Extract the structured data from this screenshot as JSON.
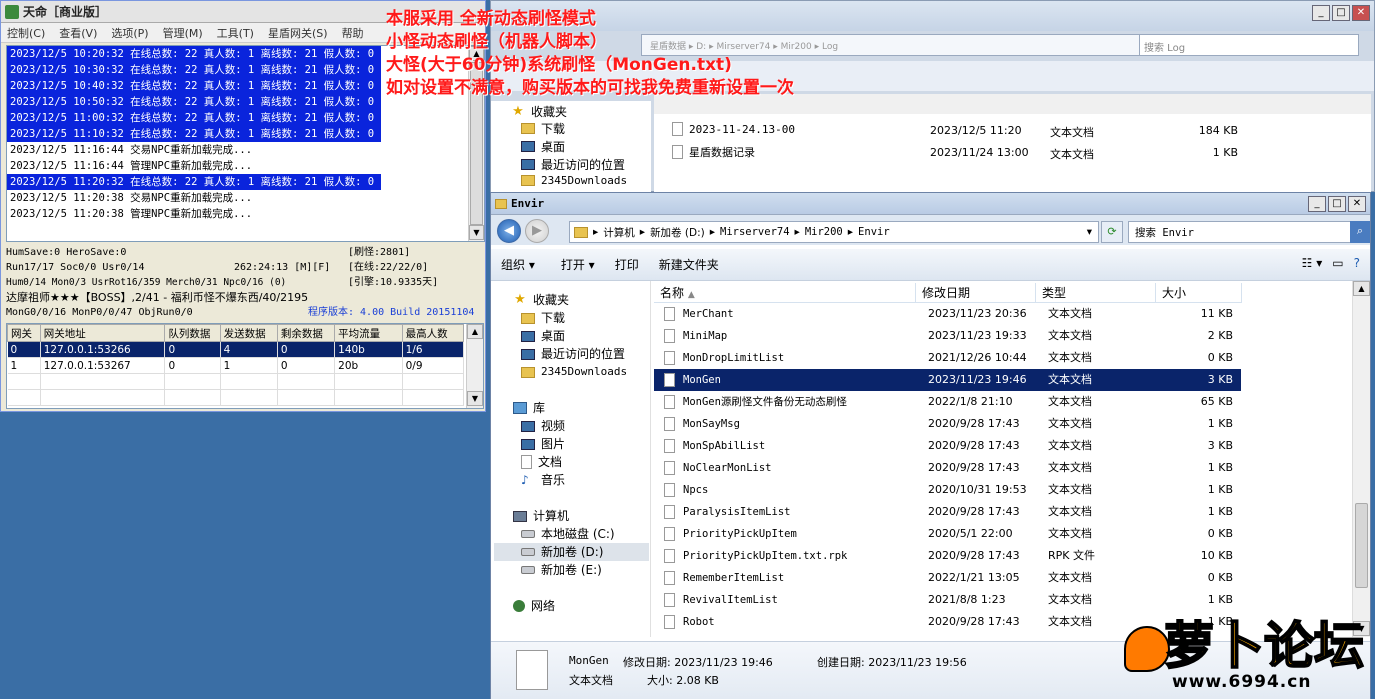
{
  "overlay": {
    "lines": [
      "本服采用 全新动态刷怪模式",
      "小怪动态刷怪（机器人脚本）",
      "大怪(大于60分钟)系统刷怪（MonGen.txt)",
      "如对设置不满意，购买版本的可找我免费重新设置一次"
    ]
  },
  "server": {
    "title": "天命［商业版］",
    "menu": [
      "控制(C)",
      "查看(V)",
      "选项(P)",
      "管理(M)",
      "工具(T)",
      "星盾网关(S)",
      "帮助"
    ],
    "log": [
      {
        "text": "2023/12/5 10:20:32 在线总数: 22 真人数: 1 离线数: 21 假人数: 0",
        "sel": true
      },
      {
        "text": "2023/12/5 10:30:32 在线总数: 22 真人数: 1 离线数: 21 假人数: 0",
        "sel": true
      },
      {
        "text": "2023/12/5 10:40:32 在线总数: 22 真人数: 1 离线数: 21 假人数: 0",
        "sel": true
      },
      {
        "text": "2023/12/5 10:50:32 在线总数: 22 真人数: 1 离线数: 21 假人数: 0",
        "sel": true
      },
      {
        "text": "2023/12/5 11:00:32 在线总数: 22 真人数: 1 离线数: 21 假人数: 0",
        "sel": true
      },
      {
        "text": "2023/12/5 11:10:32 在线总数: 22 真人数: 1 离线数: 21 假人数: 0",
        "sel": true
      },
      {
        "text": "2023/12/5 11:16:44 交易NPC重新加载完成...",
        "sel": false
      },
      {
        "text": "2023/12/5 11:16:44 管理NPC重新加载完成...",
        "sel": false
      },
      {
        "text": "2023/12/5 11:20:32 在线总数: 22 真人数: 1 离线数: 21 假人数: 0",
        "sel": true
      },
      {
        "text": "2023/12/5 11:20:38 交易NPC重新加载完成...",
        "sel": false
      },
      {
        "text": "2023/12/5 11:20:38 管理NPC重新加载完成...",
        "sel": false
      }
    ],
    "status": {
      "l1": "HumSave:0 HeroSave:0",
      "r1": "[刷怪:2801]",
      "l2": "Run17/17 Soc0/0 Usr0/14",
      "mid2": "262:24:13 [M][F]",
      "r2": "[在线:22/22/0]",
      "l3": "Hum0/14 Mon0/3 UsrRot16/359 Merch0/31 Npc0/16 (0)",
      "r3": "[引擎:10.9335天]",
      "l4": "达摩祖师★★★【BOSS】,2/41 - 福利币怪不爆东西/40/2195",
      "l5": "MonG0/0/16 MonP0/0/47 ObjRun0/0",
      "version": "程序版本: 4.00 Build 20151104"
    },
    "grid": {
      "headers": [
        "网关",
        "网关地址",
        "队列数据",
        "发送数据",
        "剩余数据",
        "平均流量",
        "最高人数"
      ],
      "rows": [
        [
          "0",
          "127.0.0.1:53266",
          "0",
          "4",
          "0",
          "140b",
          "1/6"
        ],
        [
          "1",
          "127.0.0.1:53267",
          "0",
          "1",
          "0",
          "20b",
          "0/9"
        ]
      ]
    }
  },
  "backwin": {
    "address": "星盾数据 ▸ D: ▸ Mirserver74 ▸ Mir200 ▸ Log",
    "search": "搜索 Log",
    "nav": [
      "收藏夹",
      "下载",
      "桌面",
      "最近访问的位置",
      "2345Downloads"
    ],
    "files": [
      {
        "name": "2023-11-24.13-00",
        "date": "2023/12/5 11:20",
        "type": "文本文档",
        "size": "184 KB"
      },
      {
        "name": "星盾数据记录",
        "date": "2023/11/24 13:00",
        "type": "文本文档",
        "size": "1 KB"
      }
    ]
  },
  "frontwin": {
    "title": "Envir",
    "breadcrumb": [
      "计算机",
      "新加卷 (D:)",
      "Mirserver74",
      "Mir200",
      "Envir"
    ],
    "search_placeholder": "搜索 Envir",
    "commands": [
      "组织 ▾",
      "打开 ▾",
      "打印",
      "新建文件夹"
    ],
    "columns": [
      "名称",
      "修改日期",
      "类型",
      "大小"
    ],
    "nav": {
      "favorites": "收藏夹",
      "downloads": "下载",
      "desktop": "桌面",
      "recent": "最近访问的位置",
      "d2345": "2345Downloads",
      "libraries": "库",
      "videos": "视频",
      "pictures": "图片",
      "documents": "文档",
      "music": "音乐",
      "computer": "计算机",
      "local_c": "本地磁盘 (C:)",
      "vol_d": "新加卷 (D:)",
      "vol_e": "新加卷 (E:)",
      "network": "网络"
    },
    "files": [
      {
        "name": "MerChant",
        "date": "2023/11/23 20:36",
        "type": "文本文档",
        "size": "11 KB",
        "sel": false
      },
      {
        "name": "MiniMap",
        "date": "2023/11/23 19:33",
        "type": "文本文档",
        "size": "2 KB",
        "sel": false
      },
      {
        "name": "MonDropLimitList",
        "date": "2021/12/26 10:44",
        "type": "文本文档",
        "size": "0 KB",
        "sel": false
      },
      {
        "name": "MonGen",
        "date": "2023/11/23 19:46",
        "type": "文本文档",
        "size": "3 KB",
        "sel": true
      },
      {
        "name": "MonGen源刷怪文件备份无动态刷怪",
        "date": "2022/1/8 21:10",
        "type": "文本文档",
        "size": "65 KB",
        "sel": false
      },
      {
        "name": "MonSayMsg",
        "date": "2020/9/28 17:43",
        "type": "文本文档",
        "size": "1 KB",
        "sel": false
      },
      {
        "name": "MonSpAbilList",
        "date": "2020/9/28 17:43",
        "type": "文本文档",
        "size": "3 KB",
        "sel": false
      },
      {
        "name": "NoClearMonList",
        "date": "2020/9/28 17:43",
        "type": "文本文档",
        "size": "1 KB",
        "sel": false
      },
      {
        "name": "Npcs",
        "date": "2020/10/31 19:53",
        "type": "文本文档",
        "size": "1 KB",
        "sel": false
      },
      {
        "name": "ParalysisItemList",
        "date": "2020/9/28 17:43",
        "type": "文本文档",
        "size": "1 KB",
        "sel": false
      },
      {
        "name": "PriorityPickUpItem",
        "date": "2020/5/1 22:00",
        "type": "文本文档",
        "size": "0 KB",
        "sel": false
      },
      {
        "name": "PriorityPickUpItem.txt.rpk",
        "date": "2020/9/28 17:43",
        "type": "RPK 文件",
        "size": "10 KB",
        "sel": false
      },
      {
        "name": "RememberItemList",
        "date": "2022/1/21 13:05",
        "type": "文本文档",
        "size": "0 KB",
        "sel": false
      },
      {
        "name": "RevivalItemList",
        "date": "2021/8/8 1:23",
        "type": "文本文档",
        "size": "1 KB",
        "sel": false
      },
      {
        "name": "Robot",
        "date": "2020/9/28 17:43",
        "type": "文本文档",
        "size": "1 KB",
        "sel": false
      }
    ],
    "details": {
      "name": "MonGen",
      "modified_label": "修改日期: 2023/11/23 19:46",
      "created_label": "创建日期: 2023/11/23 19:56",
      "type": "文本文档",
      "size_label": "大小: 2.08 KB"
    }
  },
  "watermark": {
    "text": "萝卜论坛",
    "url": "www.6994.cn"
  }
}
